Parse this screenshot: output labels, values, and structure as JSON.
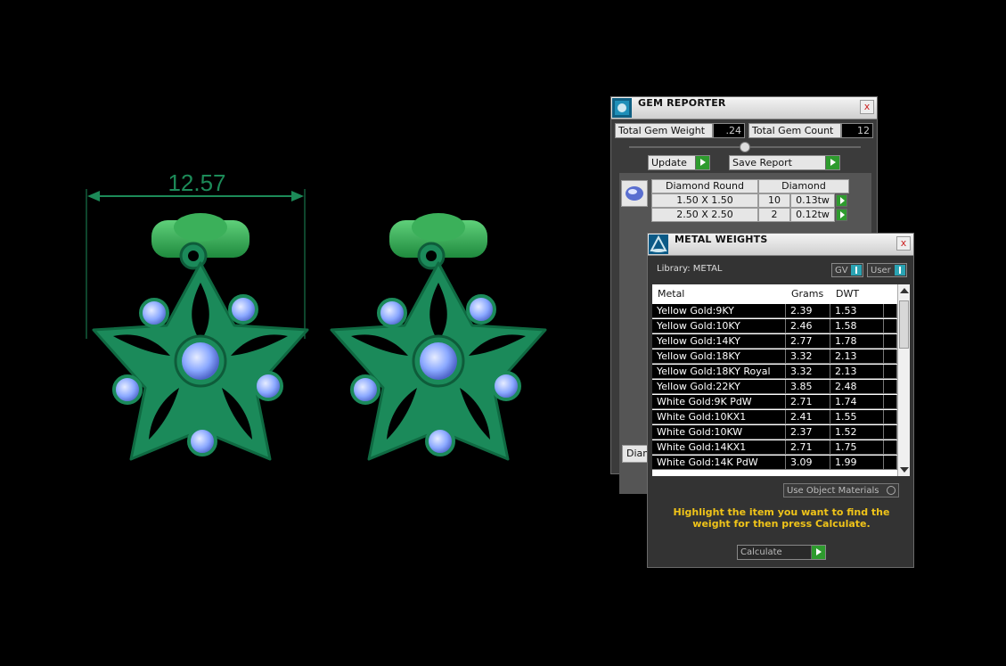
{
  "dimension": {
    "value": "12.57"
  },
  "gem_reporter": {
    "title": "GEM REPORTER",
    "close": "x",
    "total_weight_label": "Total Gem Weight",
    "total_weight_value": ".24",
    "total_count_label": "Total Gem Count",
    "total_count_value": "12",
    "update_label": "Update",
    "save_label": "Save Report",
    "table_head": {
      "shape": "Diamond Round",
      "material": "Diamond"
    },
    "rows": [
      {
        "size": "1.50 X 1.50",
        "count": "10",
        "weight": "0.13tw"
      },
      {
        "size": "2.50 X 2.50",
        "count": "2",
        "weight": "0.12tw"
      }
    ],
    "bottom_tab": "Diam"
  },
  "metal_weights": {
    "title": "METAL WEIGHTS",
    "close": "x",
    "library_label": "Library: METAL",
    "toggle_gv": "GV",
    "toggle_user": "User",
    "columns": {
      "metal": "Metal",
      "grams": "Grams",
      "dwt": "DWT"
    },
    "rows": [
      {
        "metal": "Yellow Gold:9KY",
        "grams": "2.39",
        "dwt": "1.53"
      },
      {
        "metal": "Yellow Gold:10KY",
        "grams": "2.46",
        "dwt": "1.58"
      },
      {
        "metal": "Yellow Gold:14KY",
        "grams": "2.77",
        "dwt": "1.78"
      },
      {
        "metal": "Yellow Gold:18KY",
        "grams": "3.32",
        "dwt": "2.13"
      },
      {
        "metal": "Yellow Gold:18KY Royal",
        "grams": "3.32",
        "dwt": "2.13"
      },
      {
        "metal": "Yellow Gold:22KY",
        "grams": "3.85",
        "dwt": "2.48"
      },
      {
        "metal": "White Gold:9K PdW",
        "grams": "2.71",
        "dwt": "1.74"
      },
      {
        "metal": "White Gold:10KX1",
        "grams": "2.41",
        "dwt": "1.55"
      },
      {
        "metal": "White Gold:10KW",
        "grams": "2.37",
        "dwt": "1.52"
      },
      {
        "metal": "White Gold:14KX1",
        "grams": "2.71",
        "dwt": "1.75"
      },
      {
        "metal": "White Gold:14K PdW",
        "grams": "3.09",
        "dwt": "1.99"
      }
    ],
    "use_object_materials": "Use Object Materials",
    "hint": "Highlight the item you want to find the weight for then press Calculate.",
    "calculate_label": "Calculate"
  },
  "colors": {
    "model_green": "#1b8a5a",
    "gem_blue": "#8aa8ff",
    "hint_yellow": "#f0c419"
  }
}
